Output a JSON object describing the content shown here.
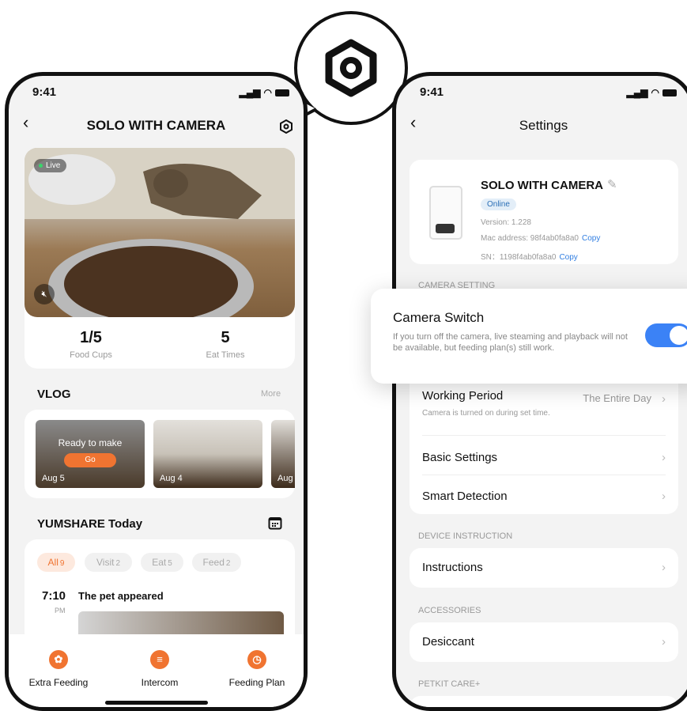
{
  "left_phone": {
    "time": "9:41",
    "title": "SOLO WITH CAMERA",
    "live_label": "Live",
    "stats": [
      {
        "value": "1/5",
        "label": "Food Cups"
      },
      {
        "value": "5",
        "label": "Eat Times"
      }
    ],
    "vlog": {
      "title": "VLOG",
      "more": "More",
      "items": [
        {
          "date": "Aug 5",
          "overlay": "Ready to make",
          "button": "Go"
        },
        {
          "date": "Aug 4"
        },
        {
          "date": "Aug"
        }
      ]
    },
    "yumshare": {
      "title": "YUMSHARE Today",
      "filters": [
        {
          "label": "All",
          "count": "9",
          "active": true
        },
        {
          "label": "Visit",
          "count": "2"
        },
        {
          "label": "Eat",
          "count": "5"
        },
        {
          "label": "Feed",
          "count": "2"
        }
      ],
      "event": {
        "time": "7:10",
        "period": "PM",
        "text": "The pet appeared"
      }
    },
    "bottom_tabs": [
      {
        "label": "Extra Feeding",
        "icon": "paw-bowl-icon"
      },
      {
        "label": "Intercom",
        "icon": "microphone-icon"
      },
      {
        "label": "Feeding Plan",
        "icon": "clock-on-icon"
      }
    ]
  },
  "right_phone": {
    "time": "9:41",
    "title": "Settings",
    "device": {
      "name": "SOLO WITH CAMERA",
      "status": "Online",
      "version": "Version: 1.228",
      "mac": "Mac address: 98f4ab0fa8a0",
      "sn": "SN：1198f4ab0fa8a0",
      "copy_label": "Copy"
    },
    "camera_setting_label": "CAMERA SETTING",
    "camera_switch": {
      "title": "Camera Switch",
      "description": "If you turn off the camera, live steaming and playback will not be available, but feeding plan(s) still work.",
      "on": true
    },
    "camera_rows": [
      {
        "label": "Working Period",
        "sub": "Camera is turned on during set time.",
        "value": "The Entire Day"
      },
      {
        "label": "Basic Settings"
      },
      {
        "label": "Smart Detection"
      }
    ],
    "device_instruction_label": "DEVICE INSTRUCTION",
    "instructions_label": "Instructions",
    "accessories_label": "ACCESSORIES",
    "desiccant_label": "Desiccant",
    "care_label": "PETKIT CARE+"
  },
  "colors": {
    "accent": "#f07431",
    "toggle_on": "#3b82f6",
    "link": "#2f7de1"
  }
}
